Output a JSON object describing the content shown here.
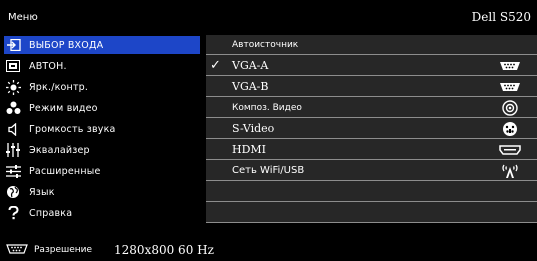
{
  "header": {
    "menu_label": "Меню",
    "model": "Dell S520"
  },
  "left_menu": [
    {
      "label": "ВЫБОР ВХОДА",
      "icon": "input-select-icon",
      "active": true
    },
    {
      "label": "АВТОН.",
      "icon": "auto-adjust-icon",
      "active": false
    },
    {
      "label": "Ярк./контр.",
      "icon": "brightness-icon",
      "active": false
    },
    {
      "label": "Режим видео",
      "icon": "video-mode-icon",
      "active": false
    },
    {
      "label": "Громкость звука",
      "icon": "speaker-icon",
      "active": false
    },
    {
      "label": "Эквалайзер",
      "icon": "equalizer-icon",
      "active": false
    },
    {
      "label": "Расширенные",
      "icon": "advanced-settings-icon",
      "active": false
    },
    {
      "label": "Язык",
      "icon": "globe-icon",
      "active": false
    },
    {
      "label": "Справка",
      "icon": "question-icon",
      "active": false
    }
  ],
  "sources": [
    {
      "label": "Автоисточник",
      "checked": false,
      "icon": ""
    },
    {
      "label": "VGA-A",
      "checked": true,
      "icon": "vga-connector-icon"
    },
    {
      "label": "VGA-B",
      "checked": false,
      "icon": "vga-connector-icon"
    },
    {
      "label": "Композ. Видео",
      "checked": false,
      "icon": "composite-video-icon"
    },
    {
      "label": "S-Video",
      "checked": false,
      "icon": "s-video-icon"
    },
    {
      "label": "HDMI",
      "checked": false,
      "icon": "hdmi-icon"
    },
    {
      "label": "Сеть  WiFi/USB",
      "checked": false,
      "icon": "wireless-icon"
    },
    {
      "label": "",
      "checked": false,
      "icon": ""
    },
    {
      "label": "",
      "checked": false,
      "icon": ""
    }
  ],
  "footer": {
    "label": "Разрешение",
    "value": "1280x800 60 Hz"
  },
  "colors": {
    "active_bg": "#1d46c8",
    "panel_bg": "#272727",
    "divider": "#8d8d8d"
  }
}
